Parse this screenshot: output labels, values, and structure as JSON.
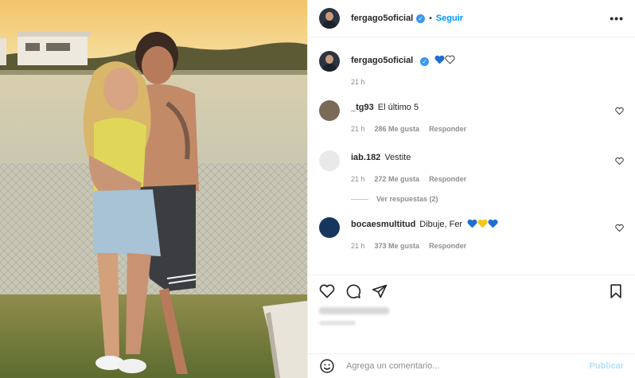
{
  "post": {
    "author": "fergago5oficial",
    "follow_label": "Seguir",
    "more_label": "•••",
    "caption": {
      "username": "fergago5oficial",
      "emojis": [
        "blue-heart",
        "white-heart"
      ],
      "time": "21 h"
    },
    "comments": [
      {
        "username": "_tg93",
        "text": "El último 5",
        "time": "21 h",
        "likes": "286 Me gusta",
        "reply": "Responder"
      },
      {
        "username": "iab.182",
        "text": "Vestite",
        "time": "21 h",
        "likes": "272 Me gusta",
        "reply": "Responder",
        "view_replies": "Ver respuestas (2)"
      },
      {
        "username": "bocaesmultitud",
        "text": "Dibuje, Fer",
        "emojis": [
          "blue-heart",
          "yellow-heart",
          "blue-heart"
        ],
        "time": "21 h",
        "likes": "373 Me gusta",
        "reply": "Responder"
      }
    ]
  },
  "add_comment": {
    "placeholder": "Agrega un comentario...",
    "publish_label": "Publicar"
  },
  "colors": {
    "accent": "#0095f6",
    "verified": "#3897f0",
    "muted": "#8e8e8e",
    "publish_disabled": "#b2dffc",
    "blue_heart": "#1f6fd1",
    "yellow_heart": "#f5c518"
  }
}
